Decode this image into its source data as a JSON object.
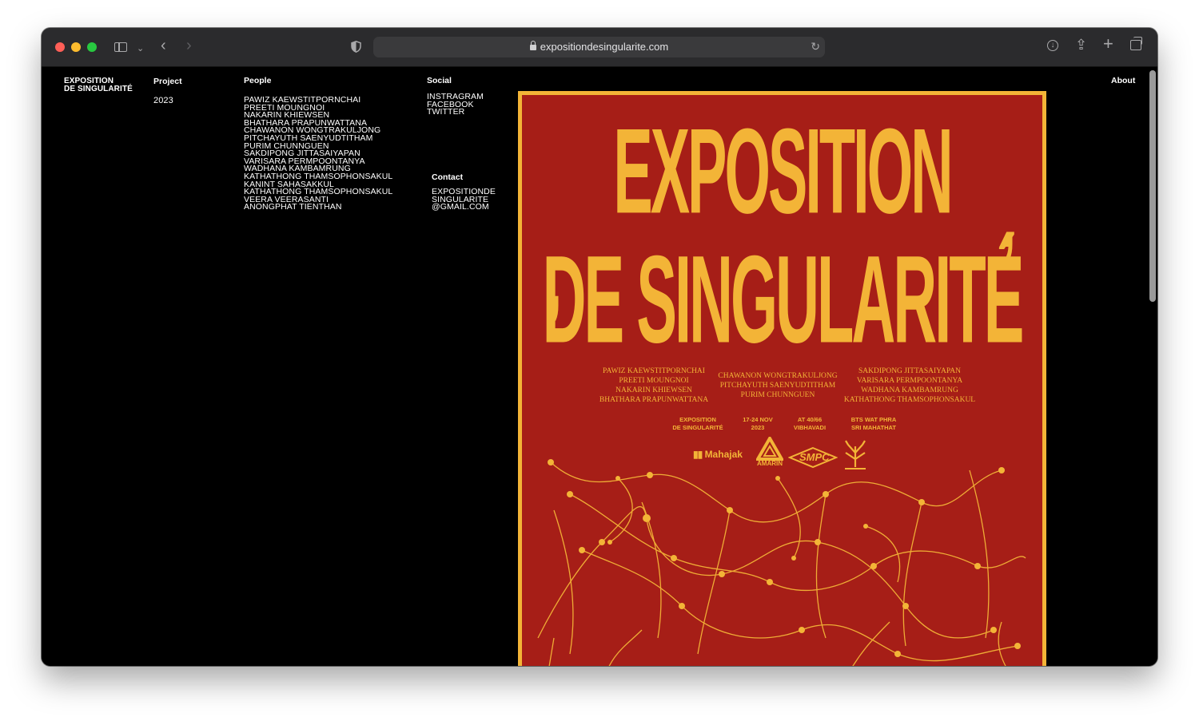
{
  "browser": {
    "url": "expositiondesingularite.com"
  },
  "site": {
    "logo_line1": "EXPOSITION",
    "logo_line2": "DE SINGULARITÉ",
    "project": {
      "heading": "Project",
      "year": "2023"
    },
    "people": {
      "heading": "People",
      "names": [
        "PAWIZ KAEWSTITPORNCHAI",
        "PREETI MOUNGNOI",
        "NAKARIN KHIEWSEN",
        "BHATHARA PRAPUNWATTANA",
        "CHAWANON WONGTRAKULJONG",
        "PITCHAYUTH SAENYUDTITHAM",
        "PURIM CHUNNGUEN",
        "SAKDIPONG JITTASAIYAPAN",
        "VARISARA PERMPOONTANYA",
        "WADHANA KAMBAMRUNG",
        "KATHATHONG THAMSOPHONSAKUL",
        "KANINT SAHASAKKUL",
        "KATHATHONG THAMSOPHONSAKUL",
        "VEERA VEERASANTI",
        "ANONGPHAT TIENTHAN"
      ]
    },
    "social": {
      "heading": "Social",
      "links": [
        "INSTRAGRAM",
        "FACEBOOK",
        "TWITTER"
      ]
    },
    "contact": {
      "heading": "Contact",
      "lines": [
        "EXPOSITIONDE",
        "SINGULARITE",
        "@GMAIL.COM"
      ]
    },
    "about": "About"
  },
  "poster": {
    "title_line1": "EXPOSITION",
    "title_line2": "DE SINGULARITÉ",
    "comma": ",",
    "names_col1": [
      "PAWIZ KAEWSTITPORNCHAI",
      "PREETI MOUNGNOI",
      "NAKARIN KHIEWSEN",
      "BHATHARA PRAPUNWATTANA"
    ],
    "names_col2": [
      "CHAWANON WONGTRAKULJONG",
      "PITCHAYUTH SAENYUDTITHAM",
      "PURIM CHUNNGUEN"
    ],
    "names_col3": [
      "SAKDIPONG JITTASAIYAPAN",
      "VARISARA PERMPOONTANYA",
      "WADHANA KAMBAMRUNG",
      "KATHATHONG THAMSOPHONSAKUL"
    ],
    "info": [
      [
        "EXPOSITION",
        "DE SINGULARITÉ"
      ],
      [
        "17-24 NOV",
        "2023"
      ],
      [
        "AT 40/66",
        "VIBHAVADI"
      ],
      [
        "BTS WAT PHRA",
        "SRI MAHATHAT"
      ]
    ],
    "sponsors": [
      "Mahajak",
      "AMARIN",
      "SMPC"
    ],
    "colors": {
      "red": "#a61e17",
      "yellow": "#f3b437"
    }
  }
}
